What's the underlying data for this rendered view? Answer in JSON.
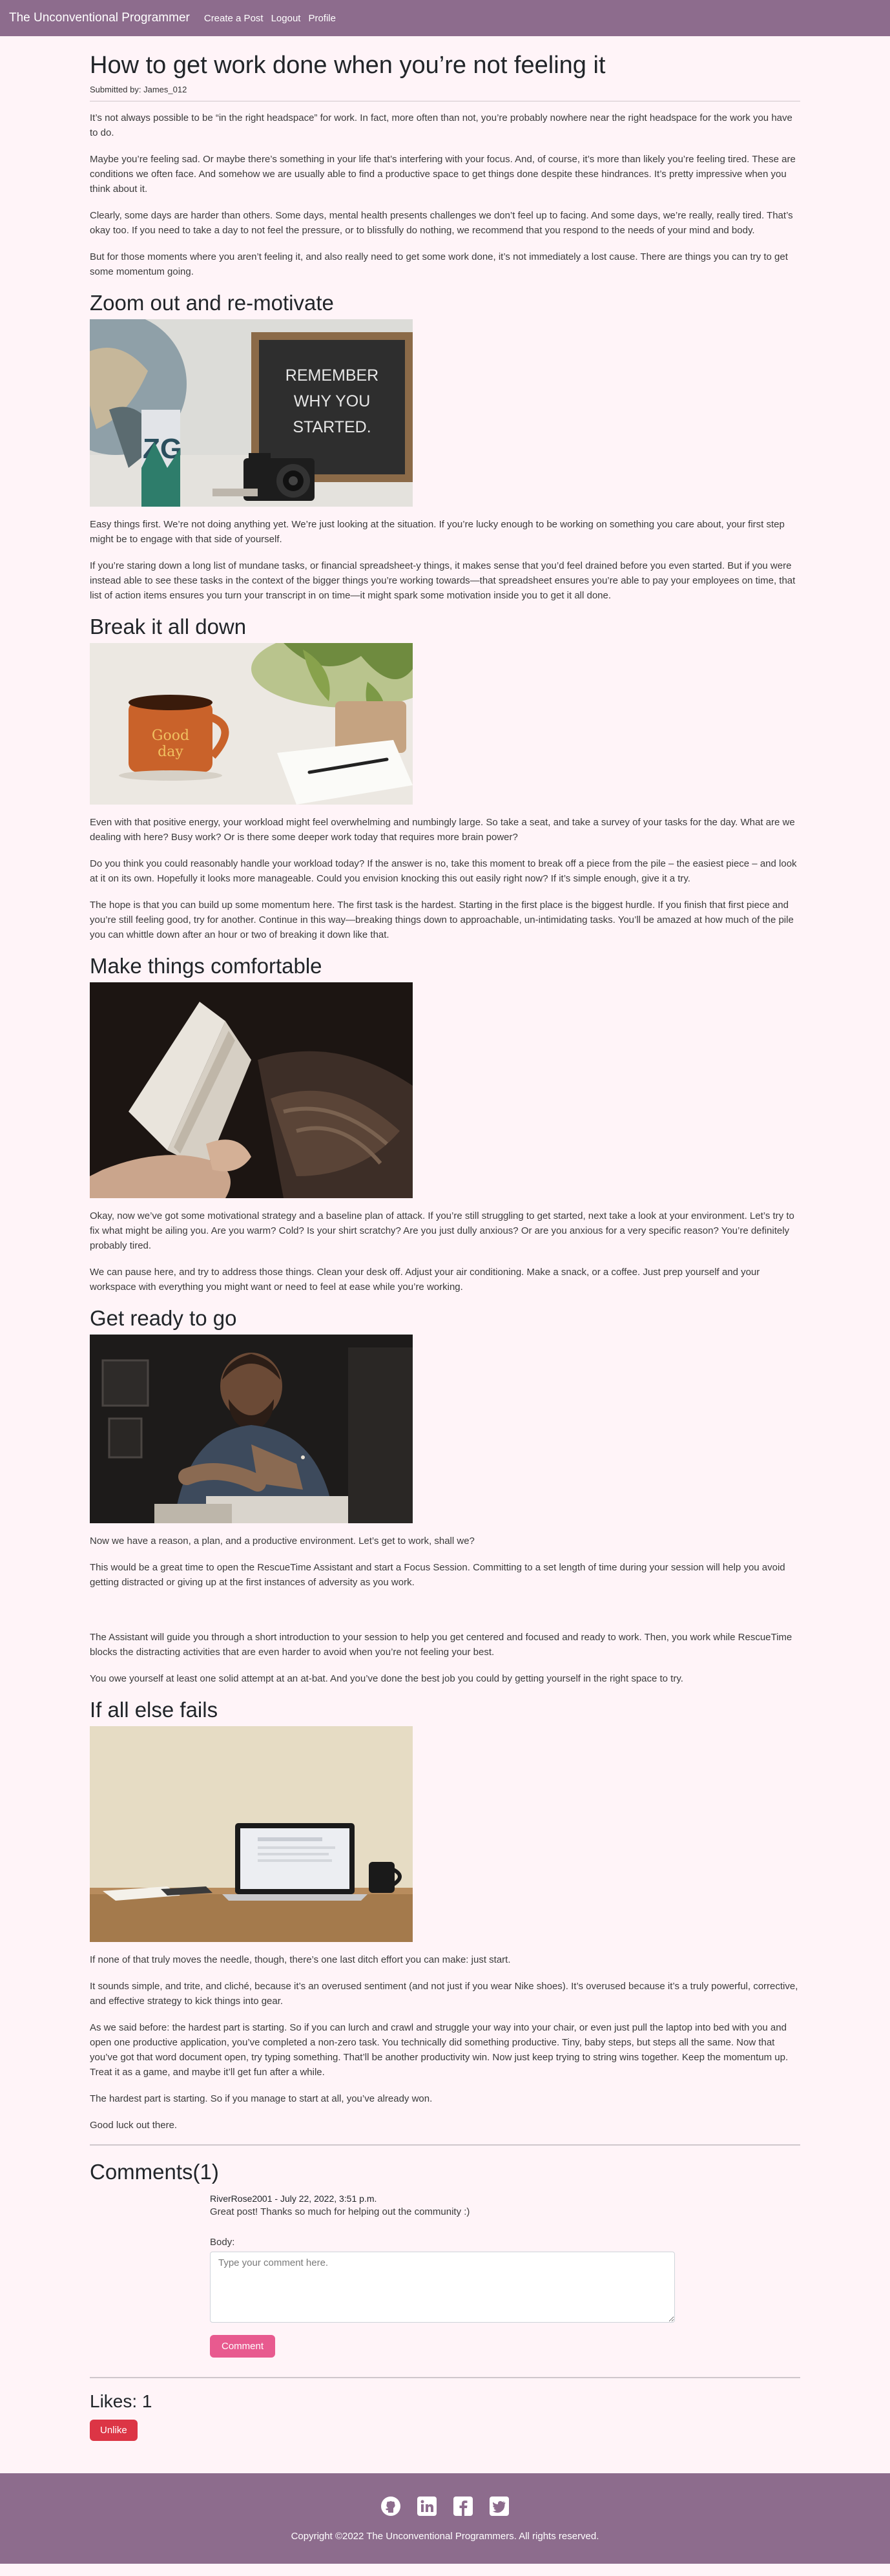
{
  "nav": {
    "brand": "The Unconventional Programmer",
    "links": [
      "Create a Post",
      "Logout",
      "Profile"
    ]
  },
  "post": {
    "title": "How to get work done when you’re not feeling it",
    "byline": "Submitted by: James_012",
    "intro": [
      "It’s not always possible to be “in the right headspace” for work. In fact, more often than not, you’re probably nowhere near the right headspace for the work you have to do.",
      "Maybe you’re feeling sad. Or maybe there’s something in your life that’s interfering with your focus. And, of course, it’s more than likely you’re feeling tired. These are conditions we often face. And somehow we are usually able to find a productive space to get things done despite these hindrances. It’s pretty impressive when you think about it.",
      "Clearly, some days are harder than others. Some days, mental health presents challenges we don’t feel up to facing. And some days, we’re really, really tired. That’s okay too. If you need to take a day to not feel the pressure, or to blissfully do nothing, we recommend that you respond to the needs of your mind and body.",
      "But for those moments where you aren’t feeling it, and also really need to get some work done, it’s not immediately a lost cause. There are things you can try to get some momentum going."
    ],
    "sections": [
      {
        "heading": "Zoom out and re-motivate",
        "paragraphs": [
          "Easy things first. We’re not doing anything yet. We’re just looking at the situation. If you’re lucky enough to be working on something you care about, your first step might be to engage with that side of yourself.",
          "If you’re staring down a long list of mundane tasks, or financial spreadsheet-y things, it makes sense that you’d feel drained before you even started. But if you were instead able to see these tasks in the context of the bigger things you’re working towards—that spreadsheet ensures you’re able to pay your employees on time, that list of action items ensures you turn your transcript in on time—it might spark some motivation inside you to get it all done."
        ]
      },
      {
        "heading": "Break it all down",
        "paragraphs": [
          "Even with that positive energy, your workload might feel overwhelming and numbingly large. So take a seat, and take a survey of your tasks for the day. What are we dealing with here? Busy work? Or is there some deeper work today that requires more brain power?",
          "Do you think you could reasonably handle your workload today? If the answer is no, take this moment to break off a piece from the pile – the easiest piece – and look at it on its own. Hopefully it looks more manageable. Could you envision knocking this out easily right now? If it’s simple enough, give it a try.",
          "The hope is that you can build up some momentum here. The first task is the hardest. Starting in the first place is the biggest hurdle. If you finish that first piece and you’re still feeling good, try for another. Continue in this way—breaking things down to approachable, un-intimidating tasks. You’ll be amazed at how much of the pile you can whittle down after an hour or two of breaking it down like that."
        ]
      },
      {
        "heading": "Make things comfortable",
        "paragraphs": [
          "Okay, now we’ve got some motivational strategy and a baseline plan of attack. If you’re still struggling to get started, next take a look at your environment. Let’s try to fix what might be ailing you. Are you warm? Cold? Is your shirt scratchy? Are you just dully anxious? Or are you anxious for a very specific reason? You’re definitely probably tired.",
          "We can pause here, and try to address those things. Clean your desk off. Adjust your air conditioning. Make a snack, or a coffee. Just prep yourself and your workspace with everything you might want or need to feel at ease while you’re working."
        ]
      },
      {
        "heading": "Get ready to go",
        "paragraphs": [
          "Now we have a reason, a plan, and a productive environment. Let’s get to work, shall we?",
          "This would be a great time to open the RescueTime Assistant and start a Focus Session. Committing to a set length of time during your session will help you avoid getting distracted or giving up at the first instances of adversity as you work.",
          "",
          "The Assistant will guide you through a short introduction to your session to help you get centered and focused and ready to work. Then, you work while RescueTime blocks the distracting activities that are even harder to avoid when you’re not feeling your best.",
          "You owe yourself at least one solid attempt at an at-bat. And you’ve done the best job you could by getting yourself in the right space to try."
        ]
      },
      {
        "heading": "If all else fails",
        "paragraphs": [
          "If none of that truly moves the needle, though, there’s one last ditch effort you can make: just start.",
          "It sounds simple, and trite, and cliché, because it’s an overused sentiment (and not just if you wear Nike shoes). It’s overused because it’s a truly powerful, corrective, and effective strategy to kick things into gear.",
          "As we said before: the hardest part is starting. So if you can lurch and crawl and struggle your way into your chair, or even just pull the laptop into bed with you and open one productive application, you’ve completed a non-zero task. You technically did something productive. Tiny, baby steps, but steps all the same. Now that you’ve got that word document open, try typing something. That’ll be another productivity win. Now just keep trying to string wins together. Keep the momentum up. Treat it as a game, and maybe it’ll get fun after a while.",
          "The hardest part is starting. So if you manage to start at all, you’ve already won.",
          "Good luck out there."
        ]
      }
    ],
    "photo_text": [
      "REMEMBER",
      "WHY YOU",
      "STARTED."
    ]
  },
  "comments": {
    "title": "Comments(1)",
    "items": [
      {
        "author": "RiverRose2001",
        "date": " - July 22, 2022, 3:51 p.m.",
        "text": "Great post! Thanks so much for helping out the community :)"
      }
    ],
    "body_label": "Body:",
    "placeholder": "Type your comment here.",
    "submit_label": "Comment"
  },
  "likes": {
    "label": "Likes: 1",
    "unlike_label": "Unlike"
  },
  "footer": {
    "icons": [
      "github-icon",
      "linkedin-icon",
      "facebook-icon",
      "twitter-icon"
    ],
    "copyright": "Copyright ©2022 The Unconventional Programmers. All rights reserved."
  },
  "colors": {
    "nav_bg": "#8d6c8d",
    "page_bg": "#fff4f8",
    "comment_button": "#e85a8f",
    "unlike_button": "#dc3545"
  }
}
